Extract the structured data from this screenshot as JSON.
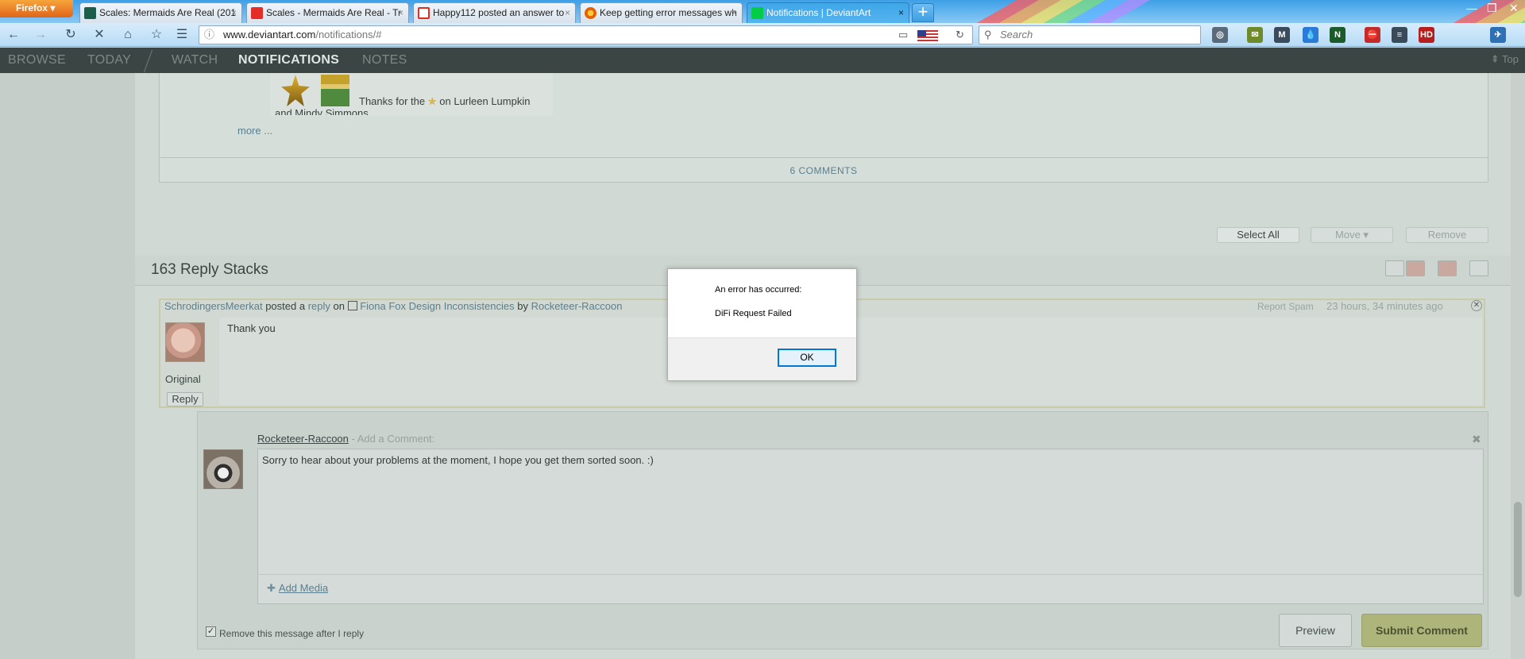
{
  "browser": {
    "menu_label": "Firefox",
    "tabs": [
      {
        "title": "Scales: Mermaids Are Real (201",
        "icon": "film-icon",
        "color": "#1b5e4b"
      },
      {
        "title": "Scales - Mermaids Are Real - Tr",
        "icon": "youtube-icon",
        "color": "#e52d27"
      },
      {
        "title": "Happy112 posted an answer to",
        "icon": "gmail-icon",
        "color": "#d93025"
      },
      {
        "title": "Keep getting error messages wh",
        "icon": "firefox-icon",
        "color": "#e66000"
      },
      {
        "title": "Notifications | DeviantArt",
        "icon": "deviantart-icon",
        "color": "#05cc47"
      }
    ],
    "url_host": "www.deviantart.com",
    "url_path": "/notifications/#",
    "search_placeholder": "Search"
  },
  "da_nav": {
    "items": [
      "BROWSE",
      "TODAY",
      "WATCH",
      "NOTIFICATIONS",
      "NOTES"
    ],
    "active": "NOTIFICATIONS",
    "top_label": "Top"
  },
  "feed": {
    "thumb_caption_prefix": "Thanks for the",
    "thumb_caption_suffix": "on Lurleen Lumpkin",
    "thumb_caption_line2": "and Mindy Simmons",
    "more_label": "more ...",
    "comments_label": "6 COMMENTS",
    "select_all_label": "Select All",
    "move_label": "Move ▾",
    "remove_label": "Remove",
    "reply_stacks_title": "163 Reply Stacks"
  },
  "message": {
    "author": "SchrodingersMeerkat",
    "text_posted": "posted a",
    "reply_word": "reply",
    "text_on": "on",
    "deviation": "Fiona Fox Design Inconsistencies",
    "text_by": "by",
    "deviation_author": "Rocketeer-Raccoon",
    "report_spam": "Report Spam",
    "time": "23 hours, 34 minutes ago",
    "body": "Thank you",
    "original_label": "Original",
    "reply_label": "Reply"
  },
  "reply_form": {
    "user": "Rocketeer-Raccoon",
    "add_comment_label": "- Add a Comment:",
    "comment_text": "Sorry to hear about your problems at the moment, I hope you get them sorted soon. :)",
    "add_media_label": "Add Media",
    "remove_after_reply_label": "Remove this message after I reply",
    "preview_label": "Preview",
    "submit_label": "Submit Comment"
  },
  "dialog": {
    "line1": "An error has occurred:",
    "line2": "DiFi Request Failed",
    "ok_label": "OK"
  },
  "colors": {
    "deviantart_green": "#05cc47",
    "dialog_focus": "#0078d7",
    "da_nav_bg": "#3b4543"
  }
}
